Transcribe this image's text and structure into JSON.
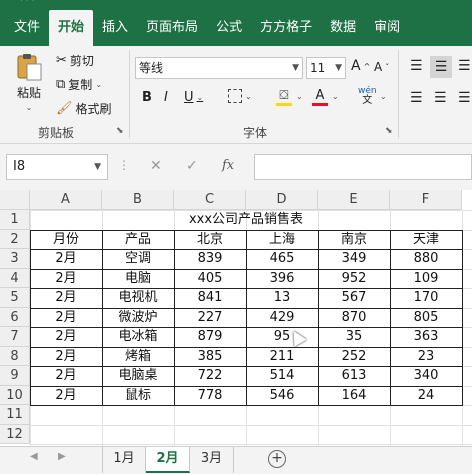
{
  "ribbon_tabs": [
    "文件",
    "开始",
    "插入",
    "页面布局",
    "公式",
    "方方格子",
    "数据",
    "审阅"
  ],
  "ribbon": {
    "paste_label": "粘贴",
    "cut_label": "剪切",
    "copy_label": "复制",
    "format_painter_label": "格式刷",
    "clipboard_group": "剪贴板",
    "font_name": "等线",
    "font_size": "11",
    "font_group": "字体",
    "bold": "B",
    "italic": "I",
    "underline": "U",
    "grow_font": "A",
    "shrink_font": "A",
    "phonetic": "wén",
    "phonetic_sub": "文"
  },
  "formula_bar": {
    "name_box": "I8",
    "cancel": "✕",
    "enter": "✓",
    "fx": "fx",
    "value": ""
  },
  "grid": {
    "columns": [
      "A",
      "B",
      "C",
      "D",
      "E",
      "F"
    ],
    "rows": [
      "1",
      "2",
      "3",
      "4",
      "5",
      "6",
      "7",
      "8",
      "9",
      "10",
      "11",
      "12"
    ],
    "title": "xxx公司产品销售表",
    "headers": [
      "月份",
      "产品",
      "北京",
      "上海",
      "南京",
      "天津"
    ],
    "data": [
      [
        "2月",
        "空调",
        "839",
        "465",
        "349",
        "880"
      ],
      [
        "2月",
        "电脑",
        "405",
        "396",
        "952",
        "109"
      ],
      [
        "2月",
        "电视机",
        "841",
        "13",
        "567",
        "170"
      ],
      [
        "2月",
        "微波炉",
        "227",
        "429",
        "870",
        "805"
      ],
      [
        "2月",
        "电冰箱",
        "879",
        "95",
        "35",
        "363"
      ],
      [
        "2月",
        "烤箱",
        "385",
        "211",
        "252",
        "23"
      ],
      [
        "2月",
        "电脑桌",
        "722",
        "514",
        "613",
        "340"
      ],
      [
        "2月",
        "鼠标",
        "778",
        "546",
        "164",
        "24"
      ]
    ]
  },
  "sheets": [
    "1月",
    "2月",
    "3月"
  ],
  "active_sheet": "2月",
  "add_sheet": "+",
  "colors": {
    "accent": "#1e7145",
    "highlight": "#ffd800",
    "font_color": "#e81123"
  }
}
